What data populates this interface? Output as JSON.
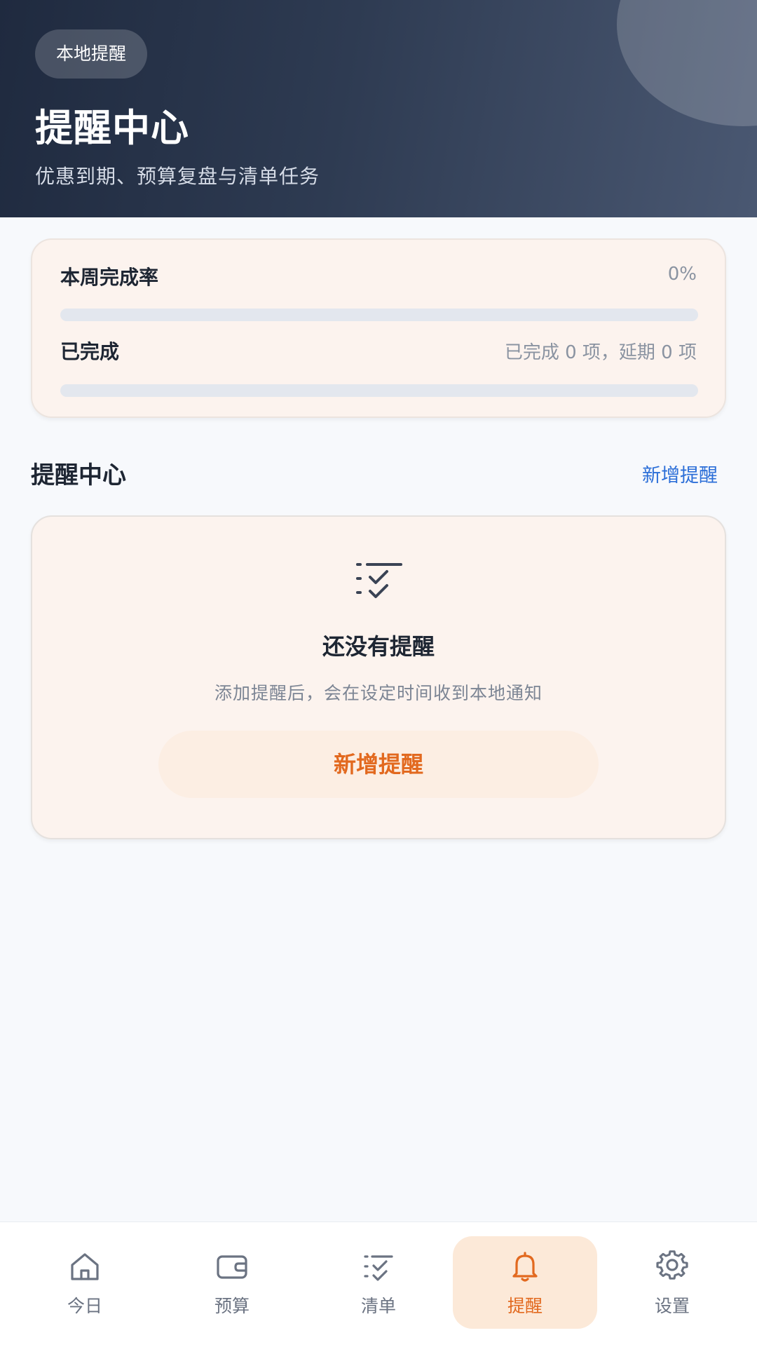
{
  "header": {
    "chip": "本地提醒",
    "title": "提醒中心",
    "subtitle": "优惠到期、预算复盘与清单任务"
  },
  "stats": {
    "completion_label": "本周完成率",
    "completion_value": "0%",
    "completion_fraction": 0,
    "done_label": "已完成",
    "done_value": "已完成 0 项，延期 0 项",
    "done_fraction": 0
  },
  "section": {
    "title": "提醒中心",
    "action": "新增提醒"
  },
  "empty": {
    "icon": "checklist-icon",
    "title": "还没有提醒",
    "desc": "添加提醒后，会在设定时间收到本地通知",
    "button": "新增提醒"
  },
  "tabs": [
    {
      "label": "今日",
      "icon": "home-icon",
      "active": false
    },
    {
      "label": "预算",
      "icon": "wallet-icon",
      "active": false
    },
    {
      "label": "清单",
      "icon": "checklist-icon",
      "active": false
    },
    {
      "label": "提醒",
      "icon": "bell-icon",
      "active": true
    },
    {
      "label": "设置",
      "icon": "gear-icon",
      "active": false
    }
  ],
  "colors": {
    "accent": "#E2691F",
    "link": "#2C6FD8",
    "header_dark": "#1F2A3F",
    "card_bg": "#FCF3EE",
    "active_tab_bg": "#FCE9D8"
  }
}
